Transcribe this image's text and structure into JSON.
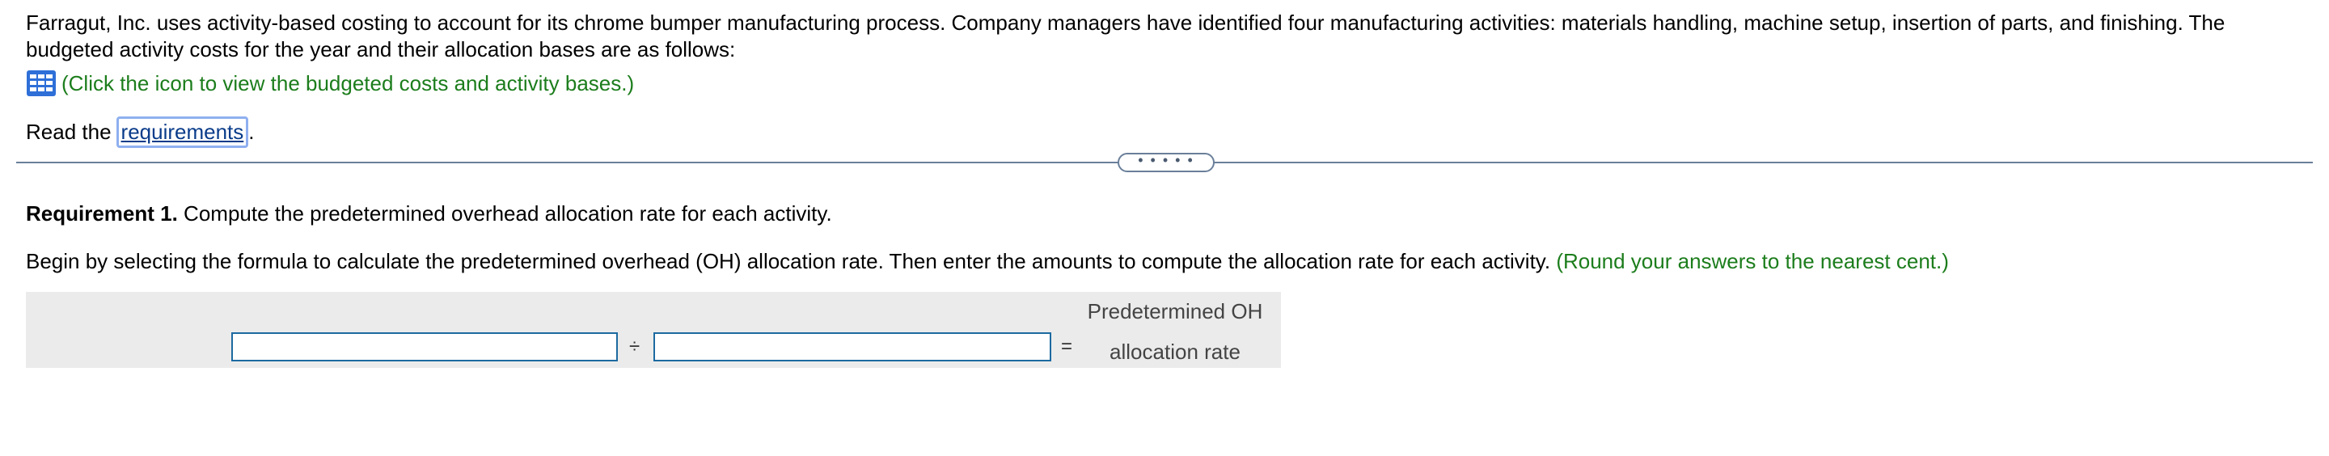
{
  "intro": {
    "text": "Farragut, Inc. uses activity-based costing to account for its chrome bumper manufacturing process. Company managers have identified four manufacturing activities: materials handling, machine setup, insertion of parts, and finishing. The budgeted activity costs for the year and their allocation bases are as follows:"
  },
  "data_link": {
    "icon": "table-grid-icon",
    "text": "(Click the icon to view the budgeted costs and activity bases.)"
  },
  "read": {
    "prefix": "Read the",
    "link": "requirements",
    "suffix": "."
  },
  "divider": {
    "handle_text": "• • • • •"
  },
  "requirement1": {
    "label": "Requirement 1.",
    "text": " Compute the predetermined overhead allocation rate for each activity."
  },
  "instructions": {
    "text": "Begin by selecting the formula to calculate the predetermined overhead (OH) allocation rate. Then enter the amounts to compute the allocation rate for each activity. ",
    "note": "(Round your answers to the nearest cent.)"
  },
  "formula": {
    "input1_value": "",
    "operator_divide": "÷",
    "input2_value": "",
    "operator_equals": "=",
    "result_line1": "Predetermined OH",
    "result_line2": "allocation rate"
  },
  "colors": {
    "green_note": "#1c7d1c",
    "link": "#0a3c8a",
    "link_focus_border": "#8fb0f0",
    "input_border": "#1c6aa0",
    "panel_bg": "#ebebeb",
    "divider": "#6a7f9a",
    "icon_blue": "#2e6fd8"
  }
}
